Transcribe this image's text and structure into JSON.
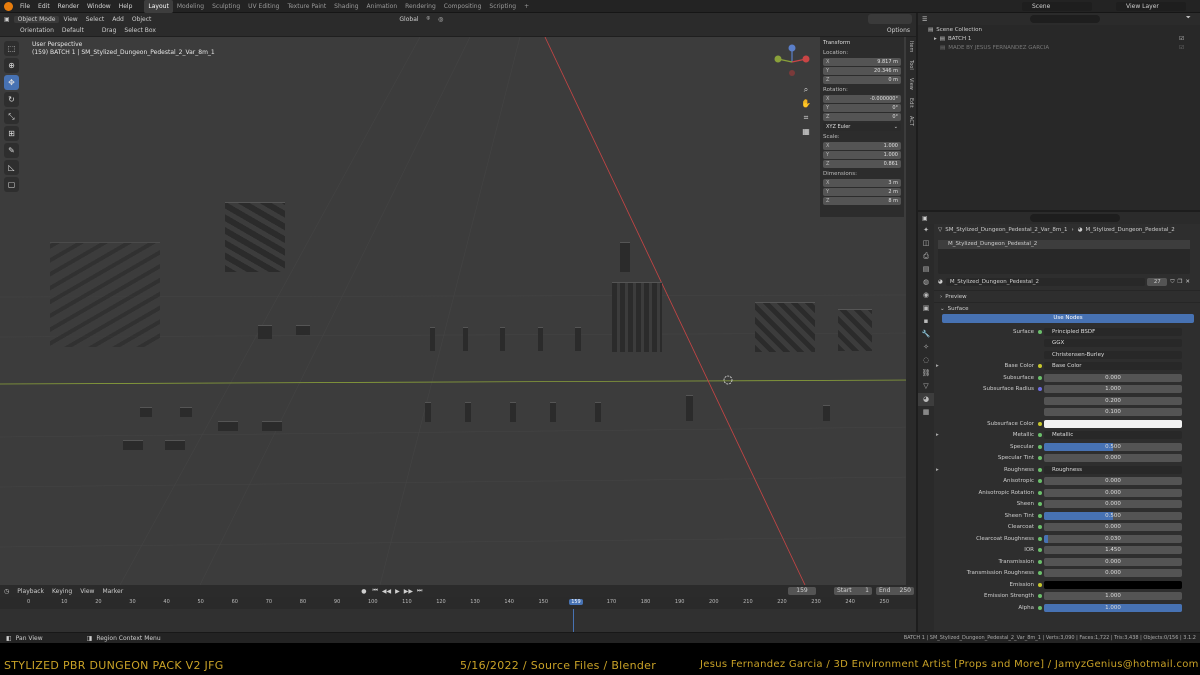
{
  "topbar": {
    "menus": [
      "File",
      "Edit",
      "Render",
      "Window",
      "Help"
    ],
    "workspaces": [
      "Layout",
      "Modeling",
      "Sculpting",
      "UV Editing",
      "Texture Paint",
      "Shading",
      "Animation",
      "Rendering",
      "Compositing",
      "Scripting"
    ],
    "active_workspace": "Layout",
    "scene": "Scene",
    "view_layer": "View Layer"
  },
  "viewport_header": {
    "mode": "Object Mode",
    "menus": [
      "View",
      "Select",
      "Add",
      "Object"
    ],
    "transform_orientation": "Global",
    "options": "Options"
  },
  "tool_settings": {
    "orientation_label": "Orientation",
    "orientation_value": "Default",
    "drag_label": "Drag",
    "drag_value": "Select Box"
  },
  "viewport_info": {
    "line1": "User Perspective",
    "line2": "(159) BATCH 1 | SM_Stylized_Dungeon_Pedestal_2_Var_8m_1"
  },
  "npanel": {
    "title": "Transform",
    "location_label": "Location:",
    "location": [
      {
        "axis": "X",
        "value": "9.817 m"
      },
      {
        "axis": "Y",
        "value": "20.346 m"
      },
      {
        "axis": "Z",
        "value": "0 m"
      }
    ],
    "rotation_label": "Rotation:",
    "rotation": [
      {
        "axis": "X",
        "value": "-0.000000°"
      },
      {
        "axis": "Y",
        "value": "0°"
      },
      {
        "axis": "Z",
        "value": "0°"
      }
    ],
    "rotation_mode": "XYZ Euler",
    "scale_label": "Scale:",
    "scale": [
      {
        "axis": "X",
        "value": "1.000"
      },
      {
        "axis": "Y",
        "value": "1.000"
      },
      {
        "axis": "Z",
        "value": "0.861"
      }
    ],
    "dimensions_label": "Dimensions:",
    "dimensions": [
      {
        "axis": "X",
        "value": "3 m"
      },
      {
        "axis": "Y",
        "value": "2 m"
      },
      {
        "axis": "Z",
        "value": "8 m"
      }
    ],
    "tabs": [
      "Item",
      "Tool",
      "View",
      "Edit",
      "ACT"
    ]
  },
  "timeline": {
    "menus": [
      "Playback",
      "Keying",
      "View",
      "Marker"
    ],
    "current_frame": "159",
    "start_label": "Start",
    "start": "1",
    "end_label": "End",
    "end": "250",
    "ticks": [
      "0",
      "10",
      "20",
      "30",
      "40",
      "50",
      "60",
      "70",
      "80",
      "90",
      "100",
      "110",
      "120",
      "130",
      "140",
      "150",
      "159",
      "170",
      "180",
      "190",
      "200",
      "210",
      "220",
      "230",
      "240",
      "250"
    ]
  },
  "statusbar": {
    "left1": "Pan View",
    "left2": "Region Context Menu",
    "right": "BATCH 1 | SM_Stylized_Dungeon_Pedestal_2_Var_8m_1 | Verts:3,090 | Faces:1,722 | Tris:3,438 | Objects:0/156 | 3.1.2"
  },
  "outliner": {
    "scene_collection": "Scene Collection",
    "batch": "BATCH 1",
    "made_by": "MADE BY JESUS FERNANDEZ GARCIA"
  },
  "properties": {
    "breadcrumb_object": "SM_Stylized_Dungeon_Pedestal_2_Var_8m_1",
    "breadcrumb_material": "M_Stylized_Dungeon_Pedestal_2",
    "slot": "M_Stylized_Dungeon_Pedestal_2",
    "material_name": "M_Stylized_Dungeon_Pedestal_2",
    "users": "27",
    "preview": "Preview",
    "surface_section": "Surface",
    "use_nodes": "Use Nodes",
    "surface_label": "Surface",
    "surface_value": "Principled BSDF",
    "distribution": "GGX",
    "subsurface_method": "Christensen-Burley",
    "rows": [
      {
        "label": "Base Color",
        "value": "Base Color",
        "kind": "text",
        "dot": "y"
      },
      {
        "label": "Subsurface",
        "value": "0.000",
        "kind": "num",
        "fill": 0,
        "dot": "g"
      },
      {
        "label": "Subsurface Radius",
        "value": "1.000",
        "kind": "num",
        "fill": 0,
        "dot": "p"
      },
      {
        "label": "",
        "value": "0.200",
        "kind": "num",
        "fill": 0,
        "dot": ""
      },
      {
        "label": "",
        "value": "0.100",
        "kind": "num",
        "fill": 0,
        "dot": ""
      },
      {
        "label": "Subsurface Color",
        "value": "",
        "kind": "color",
        "dot": "y"
      },
      {
        "label": "Metallic",
        "value": "Metallic",
        "kind": "text",
        "dot": "g"
      },
      {
        "label": "Specular",
        "value": "0.500",
        "kind": "num",
        "fill": 0.5,
        "dot": "g"
      },
      {
        "label": "Specular Tint",
        "value": "0.000",
        "kind": "num",
        "fill": 0,
        "dot": "g"
      },
      {
        "label": "Roughness",
        "value": "Roughness",
        "kind": "text",
        "dot": "g"
      },
      {
        "label": "Anisotropic",
        "value": "0.000",
        "kind": "num",
        "fill": 0,
        "dot": "g"
      },
      {
        "label": "Anisotropic Rotation",
        "value": "0.000",
        "kind": "num",
        "fill": 0,
        "dot": "g"
      },
      {
        "label": "Sheen",
        "value": "0.000",
        "kind": "num",
        "fill": 0,
        "dot": "g"
      },
      {
        "label": "Sheen Tint",
        "value": "0.500",
        "kind": "num",
        "fill": 0.5,
        "dot": "g"
      },
      {
        "label": "Clearcoat",
        "value": "0.000",
        "kind": "num",
        "fill": 0,
        "dot": "g"
      },
      {
        "label": "Clearcoat Roughness",
        "value": "0.030",
        "kind": "num",
        "fill": 0.03,
        "dot": "g"
      },
      {
        "label": "IOR",
        "value": "1.450",
        "kind": "num",
        "fill": 0,
        "dot": "g"
      },
      {
        "label": "Transmission",
        "value": "0.000",
        "kind": "num",
        "fill": 0,
        "dot": "g"
      },
      {
        "label": "Transmission Roughness",
        "value": "0.000",
        "kind": "num",
        "fill": 0,
        "dot": "g"
      },
      {
        "label": "Emission",
        "value": "",
        "kind": "black",
        "dot": "y"
      },
      {
        "label": "Emission Strength",
        "value": "1.000",
        "kind": "num",
        "fill": 0,
        "dot": "g"
      },
      {
        "label": "Alpha",
        "value": "1.000",
        "kind": "num",
        "fill": 1,
        "dot": "g"
      }
    ]
  },
  "footer": {
    "left": "STYLIZED PBR DUNGEON PACK V2 JFG",
    "center": "5/16/2022 / Source Files / Blender",
    "right": "Jesus Fernandez Garcia / 3D Environment Artist [Props and More] / JamyzGenius@hotmail.com"
  },
  "colors": {
    "accent": "#4772b3",
    "footer_text": "#c9a227",
    "x_axis": "#c94545",
    "y_axis": "#8aa13a"
  }
}
